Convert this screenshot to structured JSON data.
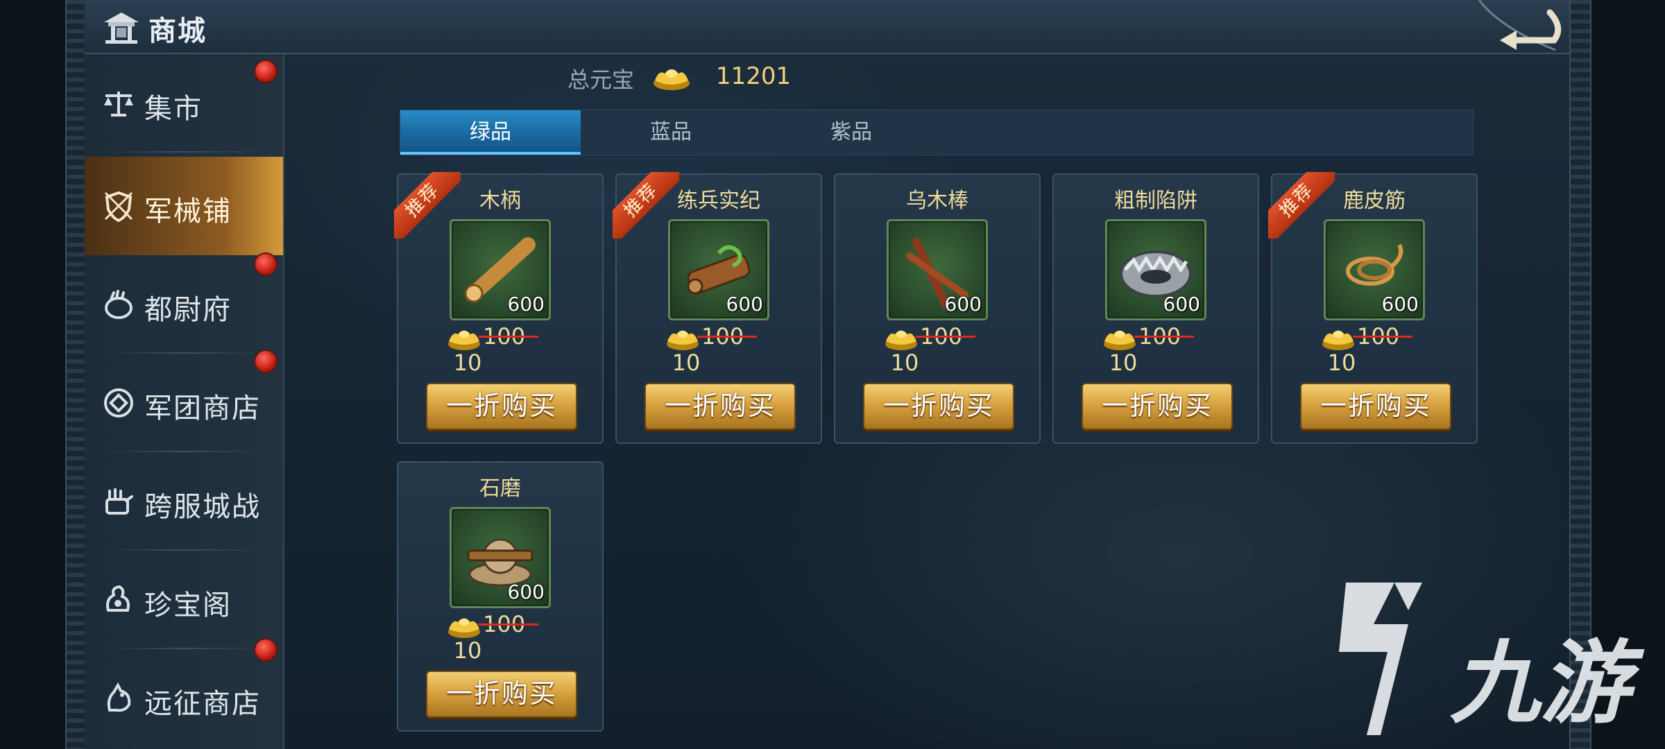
{
  "header": {
    "title": "商城",
    "back_icon": "back-arrow-icon"
  },
  "sidebar": {
    "items": [
      {
        "label": "集市",
        "icon": "scales-icon",
        "badge": true,
        "active": false
      },
      {
        "label": "军械铺",
        "icon": "shield-sword-icon",
        "badge": false,
        "active": true
      },
      {
        "label": "都尉府",
        "icon": "hand-icon",
        "badge": true,
        "active": false
      },
      {
        "label": "军团商店",
        "icon": "coin-icon",
        "badge": true,
        "active": false
      },
      {
        "label": "跨服城战",
        "icon": "fist-icon",
        "badge": false,
        "active": false
      },
      {
        "label": "珍宝阁",
        "icon": "treasure-icon",
        "badge": false,
        "active": false
      },
      {
        "label": "远征商店",
        "icon": "horse-icon",
        "badge": true,
        "active": false
      }
    ]
  },
  "currency": {
    "label": "总元宝",
    "value": "11201",
    "icon": "gold-ingot-icon"
  },
  "tabs": [
    {
      "label": "绿品",
      "active": true
    },
    {
      "label": "蓝品",
      "active": false
    },
    {
      "label": "紫品",
      "active": false
    }
  ],
  "items": [
    {
      "name": "木柄",
      "recommended": true,
      "qty": "600",
      "old_price": "100",
      "new_price": "10",
      "buy_label": "一折购买",
      "icon": "wooden-handle-icon"
    },
    {
      "name": "练兵实纪",
      "recommended": true,
      "qty": "600",
      "old_price": "100",
      "new_price": "10",
      "buy_label": "一折购买",
      "icon": "scroll-icon"
    },
    {
      "name": "乌木棒",
      "recommended": false,
      "qty": "600",
      "old_price": "100",
      "new_price": "10",
      "buy_label": "一折购买",
      "icon": "ebony-sticks-icon"
    },
    {
      "name": "粗制陷阱",
      "recommended": false,
      "qty": "600",
      "old_price": "100",
      "new_price": "10",
      "buy_label": "一折购买",
      "icon": "bear-trap-icon"
    },
    {
      "name": "鹿皮筋",
      "recommended": true,
      "qty": "600",
      "old_price": "100",
      "new_price": "10",
      "buy_label": "一折购买",
      "icon": "rope-coil-icon"
    },
    {
      "name": "石磨",
      "recommended": false,
      "qty": "600",
      "old_price": "100",
      "new_price": "10",
      "buy_label": "一折购买",
      "icon": "millstone-icon"
    }
  ],
  "recommend_label": "推荐",
  "watermark": {
    "text": "九游",
    "icon": "jiuyou-logo-icon"
  },
  "colors": {
    "gold_text": "#f0dc9a",
    "tab_active": "#1a6aa2",
    "sidebar_active": "#8c5b21",
    "badge_red": "#c41d12"
  }
}
